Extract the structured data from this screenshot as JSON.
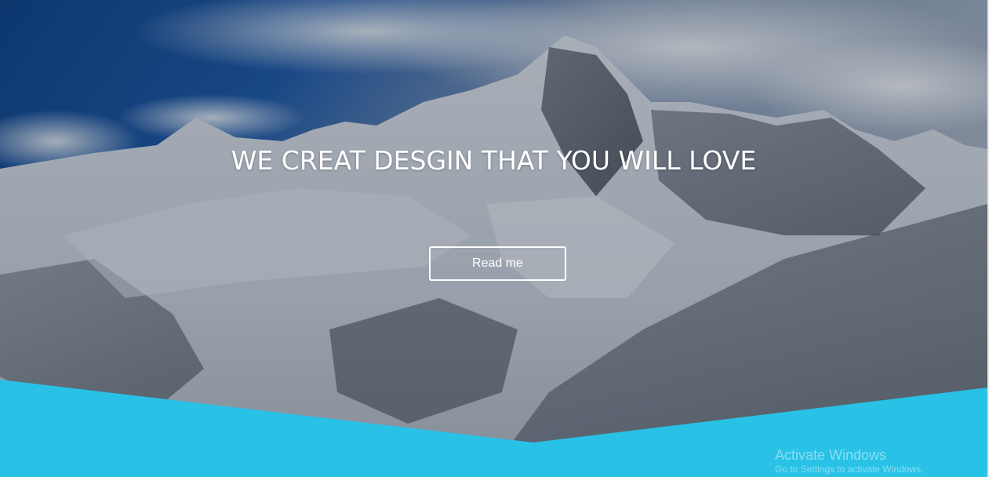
{
  "hero": {
    "title": "WE CREAT DESGIN THAT YOU WILL LOVE",
    "button_label": "Read me",
    "background": "snowy-mountain-photo",
    "overlay_color": "#1a2433"
  },
  "wave": {
    "color": "#29c2e6"
  },
  "watermark": {
    "title": "Activate Windows",
    "subtitle": "Go to Settings to activate Windows."
  }
}
